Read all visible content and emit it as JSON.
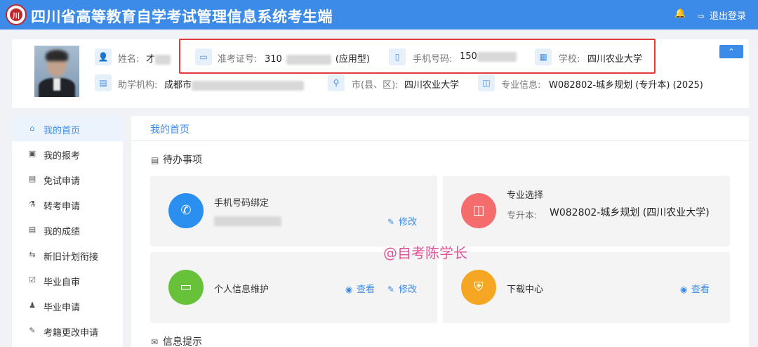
{
  "header": {
    "logo_text": "川",
    "title": "四川省高等教育自学考试管理信息系统考生端",
    "notify_icon": "bell-icon",
    "logout_label": "退出登录",
    "logout_icon": "logout-icon",
    "bg_color": "#3d8be8"
  },
  "profile": {
    "name_label": "姓名:",
    "name_value": "才",
    "admission_label": "准考证号:",
    "admission_value": "310",
    "admission_suffix": "(应用型)",
    "phone_label": "手机号码:",
    "phone_value": "150",
    "school_label": "学校:",
    "school_value": "四川农业大学",
    "agency_label": "助学机构:",
    "agency_value": "成都市",
    "city_label": "市(县、区):",
    "city_value": "四川农业大学",
    "major_label": "专业信息:",
    "major_value": "W082802-城乡规划 (专升本) (2025)",
    "collapse_icon": "chevron-up-icon",
    "highlight_color": "#e03c3c"
  },
  "sidebar": {
    "items": [
      {
        "label": "我的首页",
        "icon": "home-icon",
        "active": true
      },
      {
        "label": "我的报考",
        "icon": "briefcase-icon"
      },
      {
        "label": "免试申请",
        "icon": "document-icon"
      },
      {
        "label": "转考申请",
        "icon": "transfer-icon"
      },
      {
        "label": "我的成绩",
        "icon": "score-icon"
      },
      {
        "label": "新旧计划衔接",
        "icon": "switch-icon"
      },
      {
        "label": "毕业自审",
        "icon": "check-document-icon"
      },
      {
        "label": "毕业申请",
        "icon": "graduate-icon"
      },
      {
        "label": "考籍更改申请",
        "icon": "edit-icon"
      }
    ]
  },
  "main": {
    "tab_label": "我的首页",
    "todo_title": "待办事项",
    "info_title": "信息提示",
    "cards": {
      "phone": {
        "title": "手机号码绑定",
        "edit": "修改",
        "color": "#2b8ff0"
      },
      "major": {
        "title": "专业选择",
        "label": "专升本:",
        "value": "W082802-城乡规划 (四川农业大学)",
        "color": "#f56c6c"
      },
      "personal": {
        "title": "个人信息维护",
        "view": "查看",
        "edit": "修改",
        "color": "#67c23a"
      },
      "download": {
        "title": "下载中心",
        "view": "查看",
        "color": "#f5a623"
      }
    }
  },
  "watermark": "@自考陈学长"
}
